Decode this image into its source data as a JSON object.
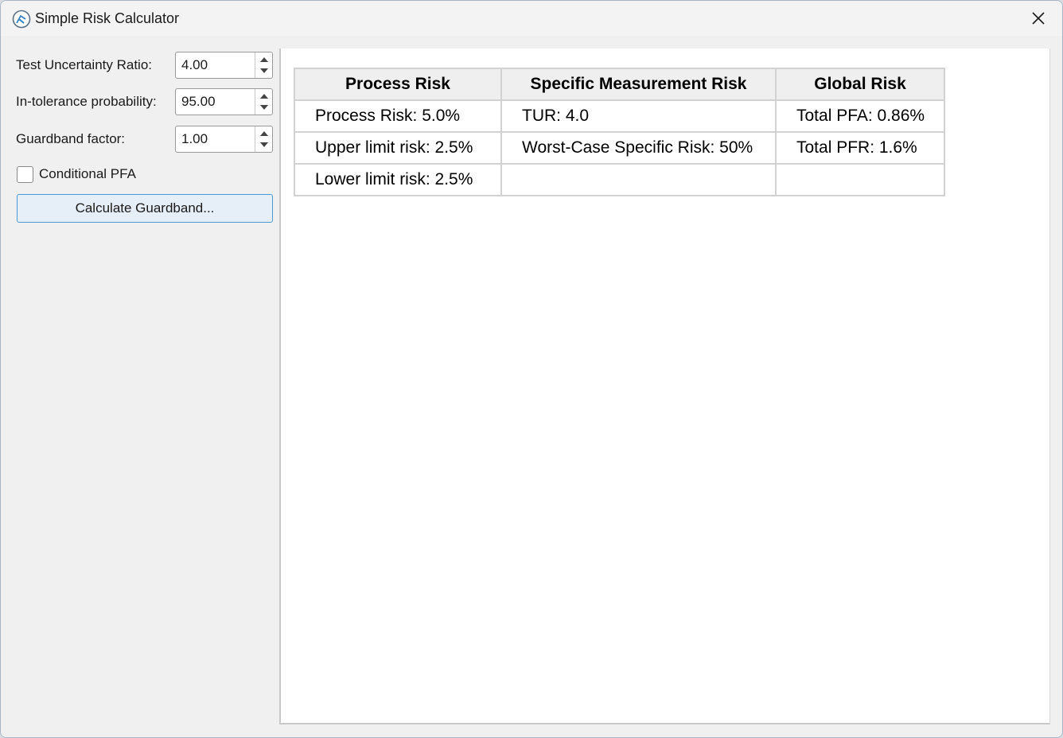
{
  "window": {
    "title": "Simple Risk Calculator"
  },
  "form": {
    "tur_label": "Test Uncertainty Ratio:",
    "tur_value": "4.00",
    "itp_label": "In-tolerance probability:",
    "itp_value": "95.00",
    "gb_label": "Guardband factor:",
    "gb_value": "1.00",
    "conditional_pfa_label": "Conditional PFA",
    "conditional_pfa_checked": false,
    "calc_button_label": "Calculate Guardband..."
  },
  "table": {
    "headers": [
      "Process Risk",
      "Specific Measurement Risk",
      "Global Risk"
    ],
    "rows": [
      [
        "Process Risk: 5.0%",
        "TUR: 4.0",
        "Total PFA: 0.86%"
      ],
      [
        "Upper limit risk: 2.5%",
        "Worst-Case Specific Risk: 50%",
        "Total PFR: 1.6%"
      ],
      [
        "Lower limit risk: 2.5%",
        "",
        ""
      ]
    ]
  },
  "colors": {
    "accent": "#4a9ad6",
    "window_bg": "#f0f0f0",
    "header_bg": "#efefef"
  }
}
